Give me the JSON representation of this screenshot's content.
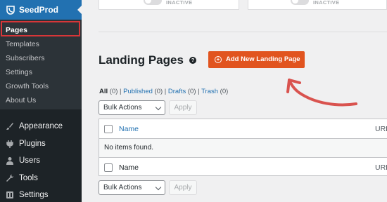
{
  "sidebar": {
    "brand": "SeedProd",
    "sub_items": [
      {
        "label": "Pages",
        "active": true
      },
      {
        "label": "Templates"
      },
      {
        "label": "Subscribers"
      },
      {
        "label": "Settings"
      },
      {
        "label": "Growth Tools"
      },
      {
        "label": "About Us"
      }
    ],
    "menu_items": [
      {
        "label": "Appearance",
        "icon": "paintbrush-icon"
      },
      {
        "label": "Plugins",
        "icon": "plug-icon"
      },
      {
        "label": "Users",
        "icon": "user-icon"
      },
      {
        "label": "Tools",
        "icon": "wrench-icon"
      },
      {
        "label": "Settings",
        "icon": "settings-icon"
      }
    ],
    "highlight_color": "#d63638"
  },
  "cards": {
    "status_1": "INACTIVE",
    "status_2": "INACTIVE"
  },
  "main": {
    "title": "Landing Pages",
    "help_icon": "?",
    "add_button": "Add New Landing Page",
    "add_button_color": "#e1541f",
    "filters": {
      "all": "All",
      "all_count": "(0)",
      "published": "Published",
      "published_count": "(0)",
      "drafts": "Drafts",
      "drafts_count": "(0)",
      "trash": "Trash",
      "trash_count": "(0)",
      "sep": "|"
    },
    "bulk_actions": "Bulk Actions",
    "apply": "Apply",
    "table": {
      "col_name": "Name",
      "col_url": "URL",
      "empty": "No items found."
    }
  }
}
